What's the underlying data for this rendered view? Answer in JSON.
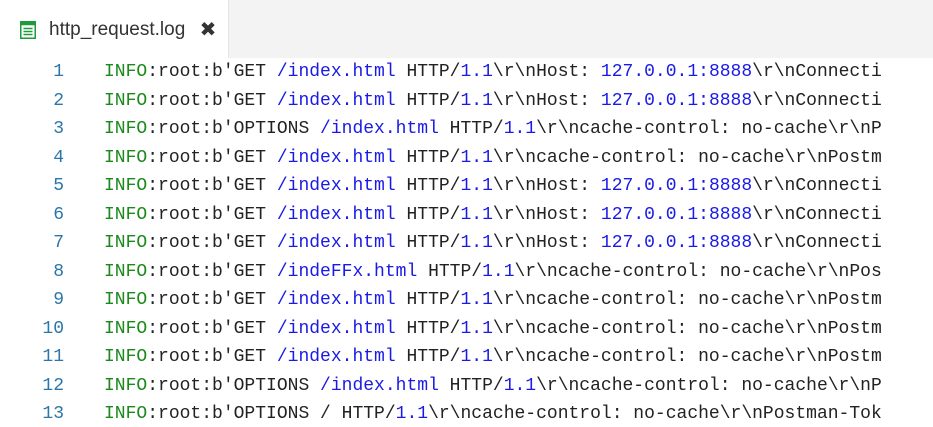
{
  "tab": {
    "title": "http_request.log",
    "close_symbol": "✖",
    "icon": "text-file-icon",
    "icon_color": "#1e9a3a"
  },
  "colors": {
    "line_number": "#2b76a8",
    "info_keyword": "#1a8a1a",
    "path_and_number": "#1a1ae6",
    "plain_text": "#222222"
  },
  "lines": [
    {
      "number": "1",
      "segments": [
        {
          "type": "info",
          "text": "INFO"
        },
        {
          "type": "plain",
          "text": ":root:b'GET "
        },
        {
          "type": "path",
          "text": "/index.html"
        },
        {
          "type": "plain",
          "text": " HTTP/"
        },
        {
          "type": "num",
          "text": "1.1"
        },
        {
          "type": "plain",
          "text": "\\r\\nHost: "
        },
        {
          "type": "num",
          "text": "127.0.0.1:8888"
        },
        {
          "type": "plain",
          "text": "\\r\\nConnecti"
        }
      ]
    },
    {
      "number": "2",
      "segments": [
        {
          "type": "info",
          "text": "INFO"
        },
        {
          "type": "plain",
          "text": ":root:b'GET "
        },
        {
          "type": "path",
          "text": "/index.html"
        },
        {
          "type": "plain",
          "text": " HTTP/"
        },
        {
          "type": "num",
          "text": "1.1"
        },
        {
          "type": "plain",
          "text": "\\r\\nHost: "
        },
        {
          "type": "num",
          "text": "127.0.0.1:8888"
        },
        {
          "type": "plain",
          "text": "\\r\\nConnecti"
        }
      ]
    },
    {
      "number": "3",
      "segments": [
        {
          "type": "info",
          "text": "INFO"
        },
        {
          "type": "plain",
          "text": ":root:b'OPTIONS "
        },
        {
          "type": "path",
          "text": "/index.html"
        },
        {
          "type": "plain",
          "text": " HTTP/"
        },
        {
          "type": "num",
          "text": "1.1"
        },
        {
          "type": "plain",
          "text": "\\r\\ncache-control: no-cache\\r\\nP"
        }
      ]
    },
    {
      "number": "4",
      "segments": [
        {
          "type": "info",
          "text": "INFO"
        },
        {
          "type": "plain",
          "text": ":root:b'GET "
        },
        {
          "type": "path",
          "text": "/index.html"
        },
        {
          "type": "plain",
          "text": " HTTP/"
        },
        {
          "type": "num",
          "text": "1.1"
        },
        {
          "type": "plain",
          "text": "\\r\\ncache-control: no-cache\\r\\nPostm"
        }
      ]
    },
    {
      "number": "5",
      "segments": [
        {
          "type": "info",
          "text": "INFO"
        },
        {
          "type": "plain",
          "text": ":root:b'GET "
        },
        {
          "type": "path",
          "text": "/index.html"
        },
        {
          "type": "plain",
          "text": " HTTP/"
        },
        {
          "type": "num",
          "text": "1.1"
        },
        {
          "type": "plain",
          "text": "\\r\\nHost: "
        },
        {
          "type": "num",
          "text": "127.0.0.1:8888"
        },
        {
          "type": "plain",
          "text": "\\r\\nConnecti"
        }
      ]
    },
    {
      "number": "6",
      "segments": [
        {
          "type": "info",
          "text": "INFO"
        },
        {
          "type": "plain",
          "text": ":root:b'GET "
        },
        {
          "type": "path",
          "text": "/index.html"
        },
        {
          "type": "plain",
          "text": " HTTP/"
        },
        {
          "type": "num",
          "text": "1.1"
        },
        {
          "type": "plain",
          "text": "\\r\\nHost: "
        },
        {
          "type": "num",
          "text": "127.0.0.1:8888"
        },
        {
          "type": "plain",
          "text": "\\r\\nConnecti"
        }
      ]
    },
    {
      "number": "7",
      "segments": [
        {
          "type": "info",
          "text": "INFO"
        },
        {
          "type": "plain",
          "text": ":root:b'GET "
        },
        {
          "type": "path",
          "text": "/index.html"
        },
        {
          "type": "plain",
          "text": " HTTP/"
        },
        {
          "type": "num",
          "text": "1.1"
        },
        {
          "type": "plain",
          "text": "\\r\\nHost: "
        },
        {
          "type": "num",
          "text": "127.0.0.1:8888"
        },
        {
          "type": "plain",
          "text": "\\r\\nConnecti"
        }
      ]
    },
    {
      "number": "8",
      "segments": [
        {
          "type": "info",
          "text": "INFO"
        },
        {
          "type": "plain",
          "text": ":root:b'GET "
        },
        {
          "type": "path",
          "text": "/indeFFx.html"
        },
        {
          "type": "plain",
          "text": " HTTP/"
        },
        {
          "type": "num",
          "text": "1.1"
        },
        {
          "type": "plain",
          "text": "\\r\\ncache-control: no-cache\\r\\nPos"
        }
      ]
    },
    {
      "number": "9",
      "segments": [
        {
          "type": "info",
          "text": "INFO"
        },
        {
          "type": "plain",
          "text": ":root:b'GET "
        },
        {
          "type": "path",
          "text": "/index.html"
        },
        {
          "type": "plain",
          "text": " HTTP/"
        },
        {
          "type": "num",
          "text": "1.1"
        },
        {
          "type": "plain",
          "text": "\\r\\ncache-control: no-cache\\r\\nPostm"
        }
      ]
    },
    {
      "number": "10",
      "segments": [
        {
          "type": "info",
          "text": "INFO"
        },
        {
          "type": "plain",
          "text": ":root:b'GET "
        },
        {
          "type": "path",
          "text": "/index.html"
        },
        {
          "type": "plain",
          "text": " HTTP/"
        },
        {
          "type": "num",
          "text": "1.1"
        },
        {
          "type": "plain",
          "text": "\\r\\ncache-control: no-cache\\r\\nPostm"
        }
      ]
    },
    {
      "number": "11",
      "segments": [
        {
          "type": "info",
          "text": "INFO"
        },
        {
          "type": "plain",
          "text": ":root:b'GET "
        },
        {
          "type": "path",
          "text": "/index.html"
        },
        {
          "type": "plain",
          "text": " HTTP/"
        },
        {
          "type": "num",
          "text": "1.1"
        },
        {
          "type": "plain",
          "text": "\\r\\ncache-control: no-cache\\r\\nPostm"
        }
      ]
    },
    {
      "number": "12",
      "segments": [
        {
          "type": "info",
          "text": "INFO"
        },
        {
          "type": "plain",
          "text": ":root:b'OPTIONS "
        },
        {
          "type": "path",
          "text": "/index.html"
        },
        {
          "type": "plain",
          "text": " HTTP/"
        },
        {
          "type": "num",
          "text": "1.1"
        },
        {
          "type": "plain",
          "text": "\\r\\ncache-control: no-cache\\r\\nP"
        }
      ]
    },
    {
      "number": "13",
      "segments": [
        {
          "type": "info",
          "text": "INFO"
        },
        {
          "type": "plain",
          "text": ":root:b'OPTIONS / HTTP/"
        },
        {
          "type": "num",
          "text": "1.1"
        },
        {
          "type": "plain",
          "text": "\\r\\ncache-control: no-cache\\r\\nPostman-Tok"
        }
      ]
    }
  ]
}
